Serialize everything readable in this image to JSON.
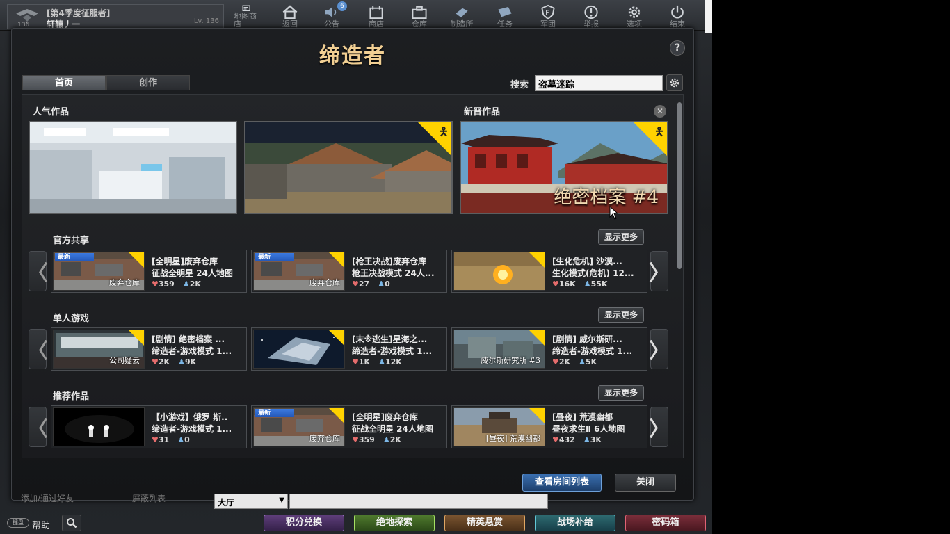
{
  "player": {
    "title": "[第4季度征服者]",
    "name": "轩辕丿一",
    "level": "Lv. 136",
    "rank_num": "136"
  },
  "topbar": [
    {
      "label": "地图商店",
      "icon": "map-store-icon"
    },
    {
      "label": "返回",
      "icon": "home-icon"
    },
    {
      "label": "公告",
      "icon": "speaker-icon",
      "badge": "6"
    },
    {
      "label": "商店",
      "icon": "shop-icon"
    },
    {
      "label": "仓库",
      "icon": "bag-icon"
    },
    {
      "label": "制造所",
      "icon": "craft-icon"
    },
    {
      "label": "任务",
      "icon": "mission-icon"
    },
    {
      "label": "军团",
      "icon": "shield-icon"
    },
    {
      "label": "举报",
      "icon": "alert-icon"
    },
    {
      "label": "选项",
      "icon": "gear-icon"
    },
    {
      "label": "结束",
      "icon": "power-icon"
    }
  ],
  "modal": {
    "title": "缔造者",
    "help": "?",
    "tabs": {
      "home": "首页",
      "create": "创作"
    },
    "search_label": "搜索",
    "search_value": "盗墓迷踪",
    "popular_title": "人气作品",
    "new_title": "新晋作品",
    "new_banner_text": "绝密档案 #4",
    "view_rooms": "查看房间列表",
    "close": "关闭"
  },
  "sections": [
    {
      "title": "官方共享",
      "more": "显示更多",
      "cards": [
        {
          "badge": "最新",
          "caption": "废弃仓库",
          "line1": "[全明星]废弃仓库",
          "line2": "征战全明星 24人地图",
          "likes": "359",
          "plays": "2K"
        },
        {
          "badge": "最新",
          "caption": "废弃仓库",
          "line1": "[枪王决战]废弃仓库",
          "line2": "枪王决战模式 24人...",
          "likes": "27",
          "plays": "0"
        },
        {
          "badge": "",
          "caption": "",
          "line1": "[生化危机] 沙漠...",
          "line2": "生化模式(危机) 12...",
          "likes": "16K",
          "plays": "55K"
        }
      ]
    },
    {
      "title": "单人游戏",
      "more": "显示更多",
      "cards": [
        {
          "badge": "",
          "caption": "公司疑云",
          "line1": "[剧情] 绝密档案 ...",
          "line2": "缔造者-游戏模式 1...",
          "likes": "2K",
          "plays": "9K"
        },
        {
          "badge": "",
          "caption": "",
          "line1": "[末※逃生]星海之...",
          "line2": "缔造者-游戏模式 1...",
          "likes": "1K",
          "plays": "12K"
        },
        {
          "badge": "",
          "caption": "威尔斯研究所 #3",
          "line1": "[剧情] 威尔斯研...",
          "line2": "缔造者-游戏模式 1...",
          "likes": "2K",
          "plays": "5K"
        }
      ]
    },
    {
      "title": "推荐作品",
      "more": "显示更多",
      "cards": [
        {
          "badge": "",
          "caption": "",
          "line1": "【小游戏】俄罗 斯..",
          "line2": "缔造者-游戏模式 1...",
          "likes": "31",
          "plays": "0"
        },
        {
          "badge": "最新",
          "caption": "废弃仓库",
          "line1": "[全明星]废弃仓库",
          "line2": "征战全明星 24人地图",
          "likes": "359",
          "plays": "2K"
        },
        {
          "badge": "",
          "caption": "[昼夜] 荒漠幽都",
          "line1": "[昼夜] 荒漠幽都",
          "line2": "昼夜求生Ⅱ 6人地图",
          "likes": "432",
          "plays": "3K"
        }
      ]
    }
  ],
  "bottom": {
    "help": "帮助",
    "help_pill": "键盘",
    "channel": "大厅",
    "friend_add": "添加/通过好友",
    "blocklist": "屏蔽列表",
    "buttons": [
      "积分兑换",
      "绝地探索",
      "精英悬赏",
      "战场补给",
      "密码箱"
    ]
  },
  "colors": {
    "title_gold": "#f1cf93",
    "corner_yellow": "#ffd200",
    "new_badge": "#3c7ae0"
  }
}
